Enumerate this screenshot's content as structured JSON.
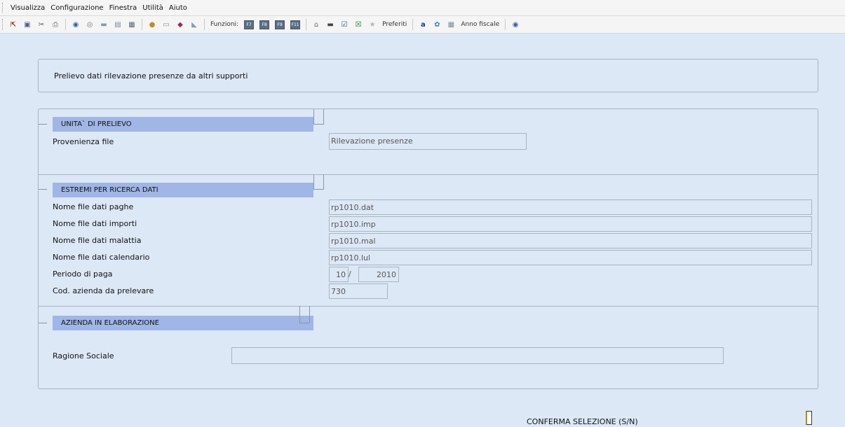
{
  "menu": [
    "Visualizza",
    "Configurazione",
    "Finestra",
    "Utilità",
    "Aiuto"
  ],
  "toolbar": {
    "funzioni_label": "Funzioni:",
    "function_keys": [
      "F7",
      "F8",
      "F9",
      "F11"
    ],
    "preferiti_label": "Preferiti",
    "anno_label": "Anno fiscale"
  },
  "title": "Prelievo dati rilevazione presenze da altri supporti",
  "sections": {
    "prelievo": {
      "header": "UNITA` DI PRELIEVO",
      "provenienza_label": "Provenienza file",
      "provenienza_value": "Rilevazione presenze"
    },
    "ricerca": {
      "header": "ESTREMI PER RICERCA DATI",
      "fields": [
        {
          "label": "Nome file dati paghe",
          "value": "rp1010.dat"
        },
        {
          "label": "Nome file dati importi",
          "value": "rp1010.imp"
        },
        {
          "label": "Nome file dati malattia",
          "value": "rp1010.mal"
        },
        {
          "label": "Nome file dati calendario",
          "value": "rp1010.lul"
        }
      ],
      "periodo_label": "Periodo di paga",
      "periodo_mese": "10",
      "periodo_sep": "/",
      "periodo_anno": "2010",
      "azienda_label": "Cod. azienda da prelevare",
      "azienda_value": "730"
    },
    "azienda": {
      "header": "AZIENDA IN ELABORAZIONE",
      "ragione_label": "Ragione Sociale",
      "ragione_value": ""
    }
  },
  "confirm": {
    "label": "CONFERMA SELEZIONE (S/N)",
    "value": ""
  }
}
